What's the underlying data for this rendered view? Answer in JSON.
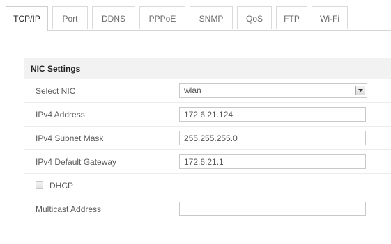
{
  "tabs": [
    {
      "label": "TCP/IP",
      "active": true
    },
    {
      "label": "Port",
      "active": false
    },
    {
      "label": "DDNS",
      "active": false
    },
    {
      "label": "PPPoE",
      "active": false
    },
    {
      "label": "SNMP",
      "active": false
    },
    {
      "label": "QoS",
      "active": false
    },
    {
      "label": "FTP",
      "active": false
    },
    {
      "label": "Wi-Fi",
      "active": false
    }
  ],
  "nic_settings": {
    "title": "NIC Settings",
    "select_nic": {
      "label": "Select NIC",
      "value": "wlan"
    },
    "ipv4_address": {
      "label": "IPv4 Address",
      "value": "172.6.21.124"
    },
    "ipv4_subnet_mask": {
      "label": "IPv4 Subnet Mask",
      "value": "255.255.255.0"
    },
    "ipv4_default_gateway": {
      "label": "IPv4 Default Gateway",
      "value": "172.6.21.1"
    },
    "dhcp": {
      "label": "DHCP",
      "checked": false
    },
    "multicast_address": {
      "label": "Multicast Address",
      "value": ""
    }
  },
  "icons": {
    "dropdown": "chevron-down-icon"
  }
}
